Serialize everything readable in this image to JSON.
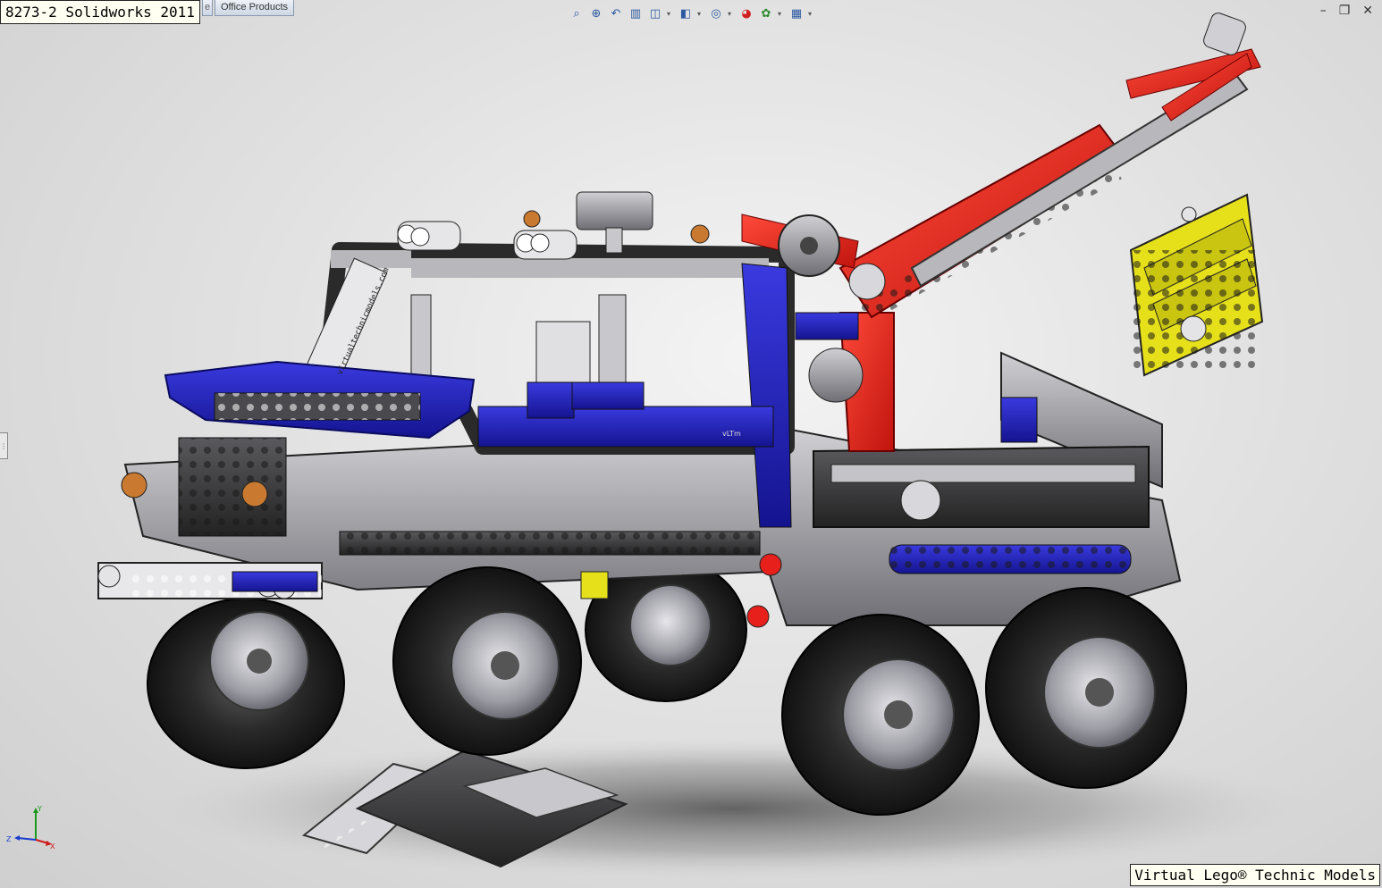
{
  "window": {
    "title": "8273-2 Solidworks 2011"
  },
  "tabs": [
    {
      "label": "e",
      "partial": true
    },
    {
      "label": "Office Products"
    }
  ],
  "heads_up_toolbar": [
    {
      "icon": "zoom-to-fit-icon",
      "glyph": "⌕"
    },
    {
      "icon": "zoom-to-area-icon",
      "glyph": "⊕"
    },
    {
      "icon": "previous-view-icon",
      "glyph": "↶"
    },
    {
      "icon": "section-view-icon",
      "glyph": "▥"
    },
    {
      "icon": "view-orientation-icon",
      "glyph": "◫",
      "dropdown": true
    },
    {
      "icon": "display-style-icon",
      "glyph": "◧",
      "dropdown": true
    },
    {
      "icon": "hide-show-items-icon",
      "glyph": "◎",
      "dropdown": true
    },
    {
      "icon": "edit-appearance-icon",
      "glyph": "◕"
    },
    {
      "icon": "apply-scene-icon",
      "glyph": "✿",
      "dropdown": true
    },
    {
      "icon": "view-settings-icon",
      "glyph": "▦",
      "dropdown": true
    }
  ],
  "window_controls": [
    {
      "icon": "minimize-icon",
      "glyph": "–"
    },
    {
      "icon": "restore-icon",
      "glyph": "❐"
    },
    {
      "icon": "close-icon",
      "glyph": "✕"
    }
  ],
  "panel_handle_glyph": "⋮",
  "triad": {
    "x": "X",
    "y": "Y",
    "z": "Z"
  },
  "part_labels": {
    "sticker_text": "virtualtechnicmodels.com",
    "beam_mark": "vLTm"
  },
  "watermark": "Virtual Lego® Technic Models",
  "colors": {
    "red": "#e8201c",
    "blue": "#1f1fb8",
    "yellow": "#e6e01a",
    "orange": "#c97a30",
    "dark_gray": "#3a3a3a",
    "light_gray": "#b8b8bc",
    "tire": "#1c1c1c"
  }
}
